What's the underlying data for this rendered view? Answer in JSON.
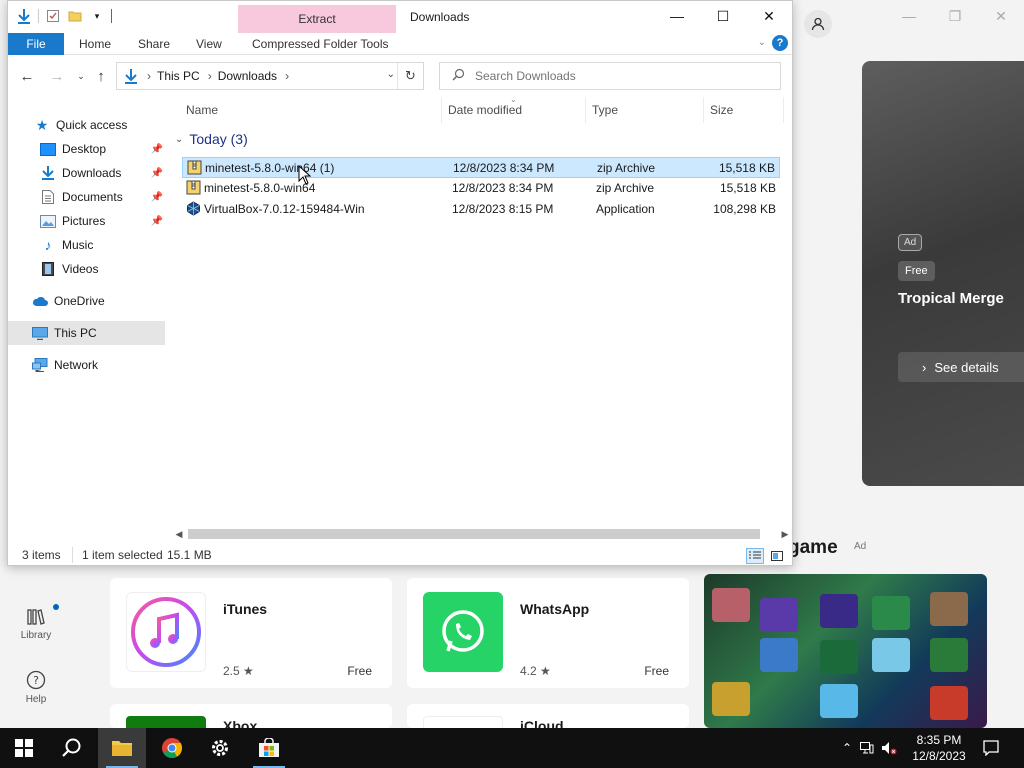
{
  "store": {
    "hero": {
      "ad_badge": "Ad",
      "free_badge": "Free",
      "title": "Tropical Merge",
      "details_button": "See details"
    },
    "section": {
      "title_fragment": "game",
      "ad_label": "Ad"
    },
    "nav": {
      "library": "Library",
      "help": "Help"
    },
    "apps": [
      {
        "name": "iTunes",
        "rating": "2.5 ★",
        "price": "Free"
      },
      {
        "name": "WhatsApp",
        "rating": "4.2 ★",
        "price": "Free"
      }
    ],
    "apps_partial": [
      "Xbox",
      "iCloud"
    ]
  },
  "explorer": {
    "window_title": "Downloads",
    "context_tab": "Extract",
    "ribbon_tabs": [
      "File",
      "Home",
      "Share",
      "View",
      "Compressed Folder Tools"
    ],
    "address": {
      "crumbs": [
        "This PC",
        "Downloads"
      ]
    },
    "search_placeholder": "Search Downloads",
    "nav_pane": {
      "quick_access": "Quick access",
      "pinned": [
        "Desktop",
        "Downloads",
        "Documents",
        "Pictures"
      ],
      "unpinned": [
        "Music",
        "Videos"
      ],
      "onedrive": "OneDrive",
      "this_pc": "This PC",
      "network": "Network"
    },
    "columns": {
      "name": "Name",
      "date": "Date modified",
      "type": "Type",
      "size": "Size"
    },
    "group": "Today (3)",
    "files": [
      {
        "name": "minetest-5.8.0-win64 (1)",
        "date": "12/8/2023 8:34 PM",
        "type": "zip Archive",
        "size": "15,518 KB"
      },
      {
        "name": "minetest-5.8.0-win64",
        "date": "12/8/2023 8:34 PM",
        "type": "zip Archive",
        "size": "15,518 KB"
      },
      {
        "name": "VirtualBox-7.0.12-159484-Win",
        "date": "12/8/2023 8:15 PM",
        "type": "Application",
        "size": "108,298 KB"
      }
    ],
    "status": {
      "count": "3 items",
      "selected": "1 item selected",
      "size": "15.1 MB"
    }
  },
  "taskbar": {
    "time": "8:35 PM",
    "date": "12/8/2023"
  },
  "colors": {
    "accent": "#1979ca",
    "context_tab": "#f8c8dc",
    "selection": "#cce8ff",
    "taskbar": "#101010"
  }
}
